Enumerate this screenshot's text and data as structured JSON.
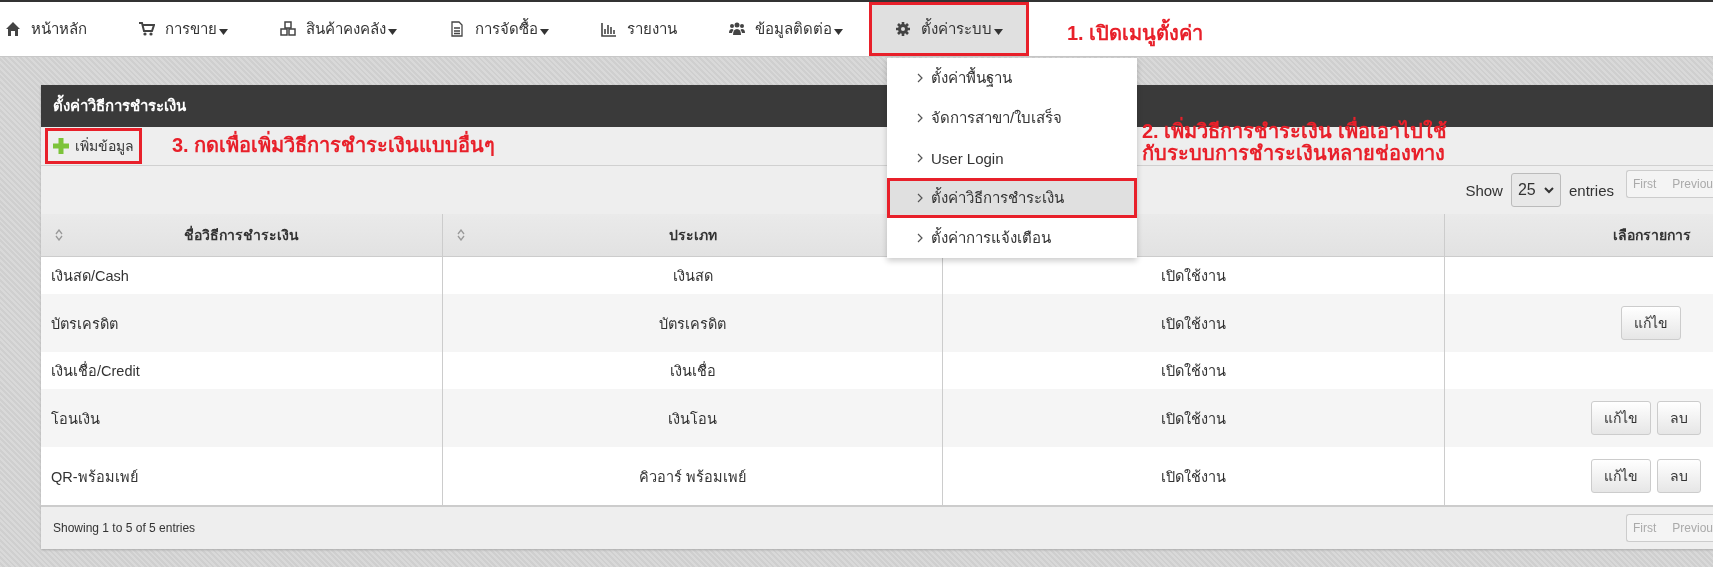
{
  "nav": [
    {
      "label": "หน้าหลัก",
      "dropdown": false,
      "selected": false,
      "annotated": false
    },
    {
      "label": "การขาย",
      "dropdown": true,
      "selected": false,
      "annotated": false
    },
    {
      "label": "สินค้าคงคลัง",
      "dropdown": true,
      "selected": false,
      "annotated": false
    },
    {
      "label": "การจัดซื้อ",
      "dropdown": true,
      "selected": false,
      "annotated": false
    },
    {
      "label": "รายงาน",
      "dropdown": false,
      "selected": false,
      "annotated": false
    },
    {
      "label": "ข้อมูลติดต่อ",
      "dropdown": true,
      "selected": false,
      "annotated": false
    },
    {
      "label": "ตั้งค่าระบบ",
      "dropdown": true,
      "selected": true,
      "annotated": true
    }
  ],
  "menu": [
    {
      "label": "ตั้งค่าพื้นฐาน",
      "selected": false,
      "annotated": false
    },
    {
      "label": "จัดการสาขา/ใบเสร็จ",
      "selected": false,
      "annotated": false
    },
    {
      "label": "User Login",
      "selected": false,
      "annotated": false
    },
    {
      "label": "ตั้งค่าวิธีการชำระเงิน",
      "selected": true,
      "annotated": true
    },
    {
      "label": "ตั้งค่าการแจ้งเตือน",
      "selected": false,
      "annotated": false
    }
  ],
  "panel": {
    "title": "ตั้งค่าวิธีการชำระเงิน",
    "add_button": "เพิ่มข้อมูล",
    "length": {
      "before": "Show",
      "value": "25",
      "after": "entries"
    },
    "pager_top": [
      "First",
      "Previou"
    ],
    "columns": [
      {
        "kind": "text",
        "label": "ชื่อวิธีการชำระเงิน",
        "sortable": true
      },
      {
        "kind": "text",
        "label": "ประเภท",
        "sortable": true
      },
      {
        "kind": "blank"
      },
      {
        "kind": "text",
        "label": "เลือกรายการ",
        "sortable": false
      }
    ],
    "rows": [
      {
        "name": "เงินสด/Cash",
        "type": "เงินสด",
        "status": "เปิดใช้งาน",
        "actions": []
      },
      {
        "name": "บัตรเครดิต",
        "type": "บัตรเครดิต",
        "status": "เปิดใช้งาน",
        "actions": [
          "แก้ไข"
        ]
      },
      {
        "name": "เงินเชื่อ/Credit",
        "type": "เงินเชื่อ",
        "status": "เปิดใช้งาน",
        "actions": []
      },
      {
        "name": "โอนเงิน",
        "type": "เงินโอน",
        "status": "เปิดใช้งาน",
        "actions": [
          "แก้ไข",
          "ลบ"
        ]
      },
      {
        "name": "QR-พร้อมเพย์",
        "type": "คิวอาร์ พร้อมเพย์",
        "status": "เปิดใช้งาน",
        "actions": [
          "แก้ไข",
          "ลบ"
        ]
      }
    ],
    "info": "Showing 1 to 5 of 5 entries",
    "pager_bottom": [
      "First",
      "Previou"
    ]
  },
  "annotations": [
    {
      "lines": [
        "1. เปิดเมนูตั้งค่า"
      ]
    },
    {
      "lines": [
        "3. กดเพื่อเพิ่มวิธีการชำระเงินแบบอื่นๆ"
      ]
    },
    {
      "lines": [
        "2. เพิ่มวิธีการชำระเงิน เพื่อเอาไปใช้",
        "กับระบบการชำระเงินหลายช่องทาง"
      ]
    }
  ]
}
